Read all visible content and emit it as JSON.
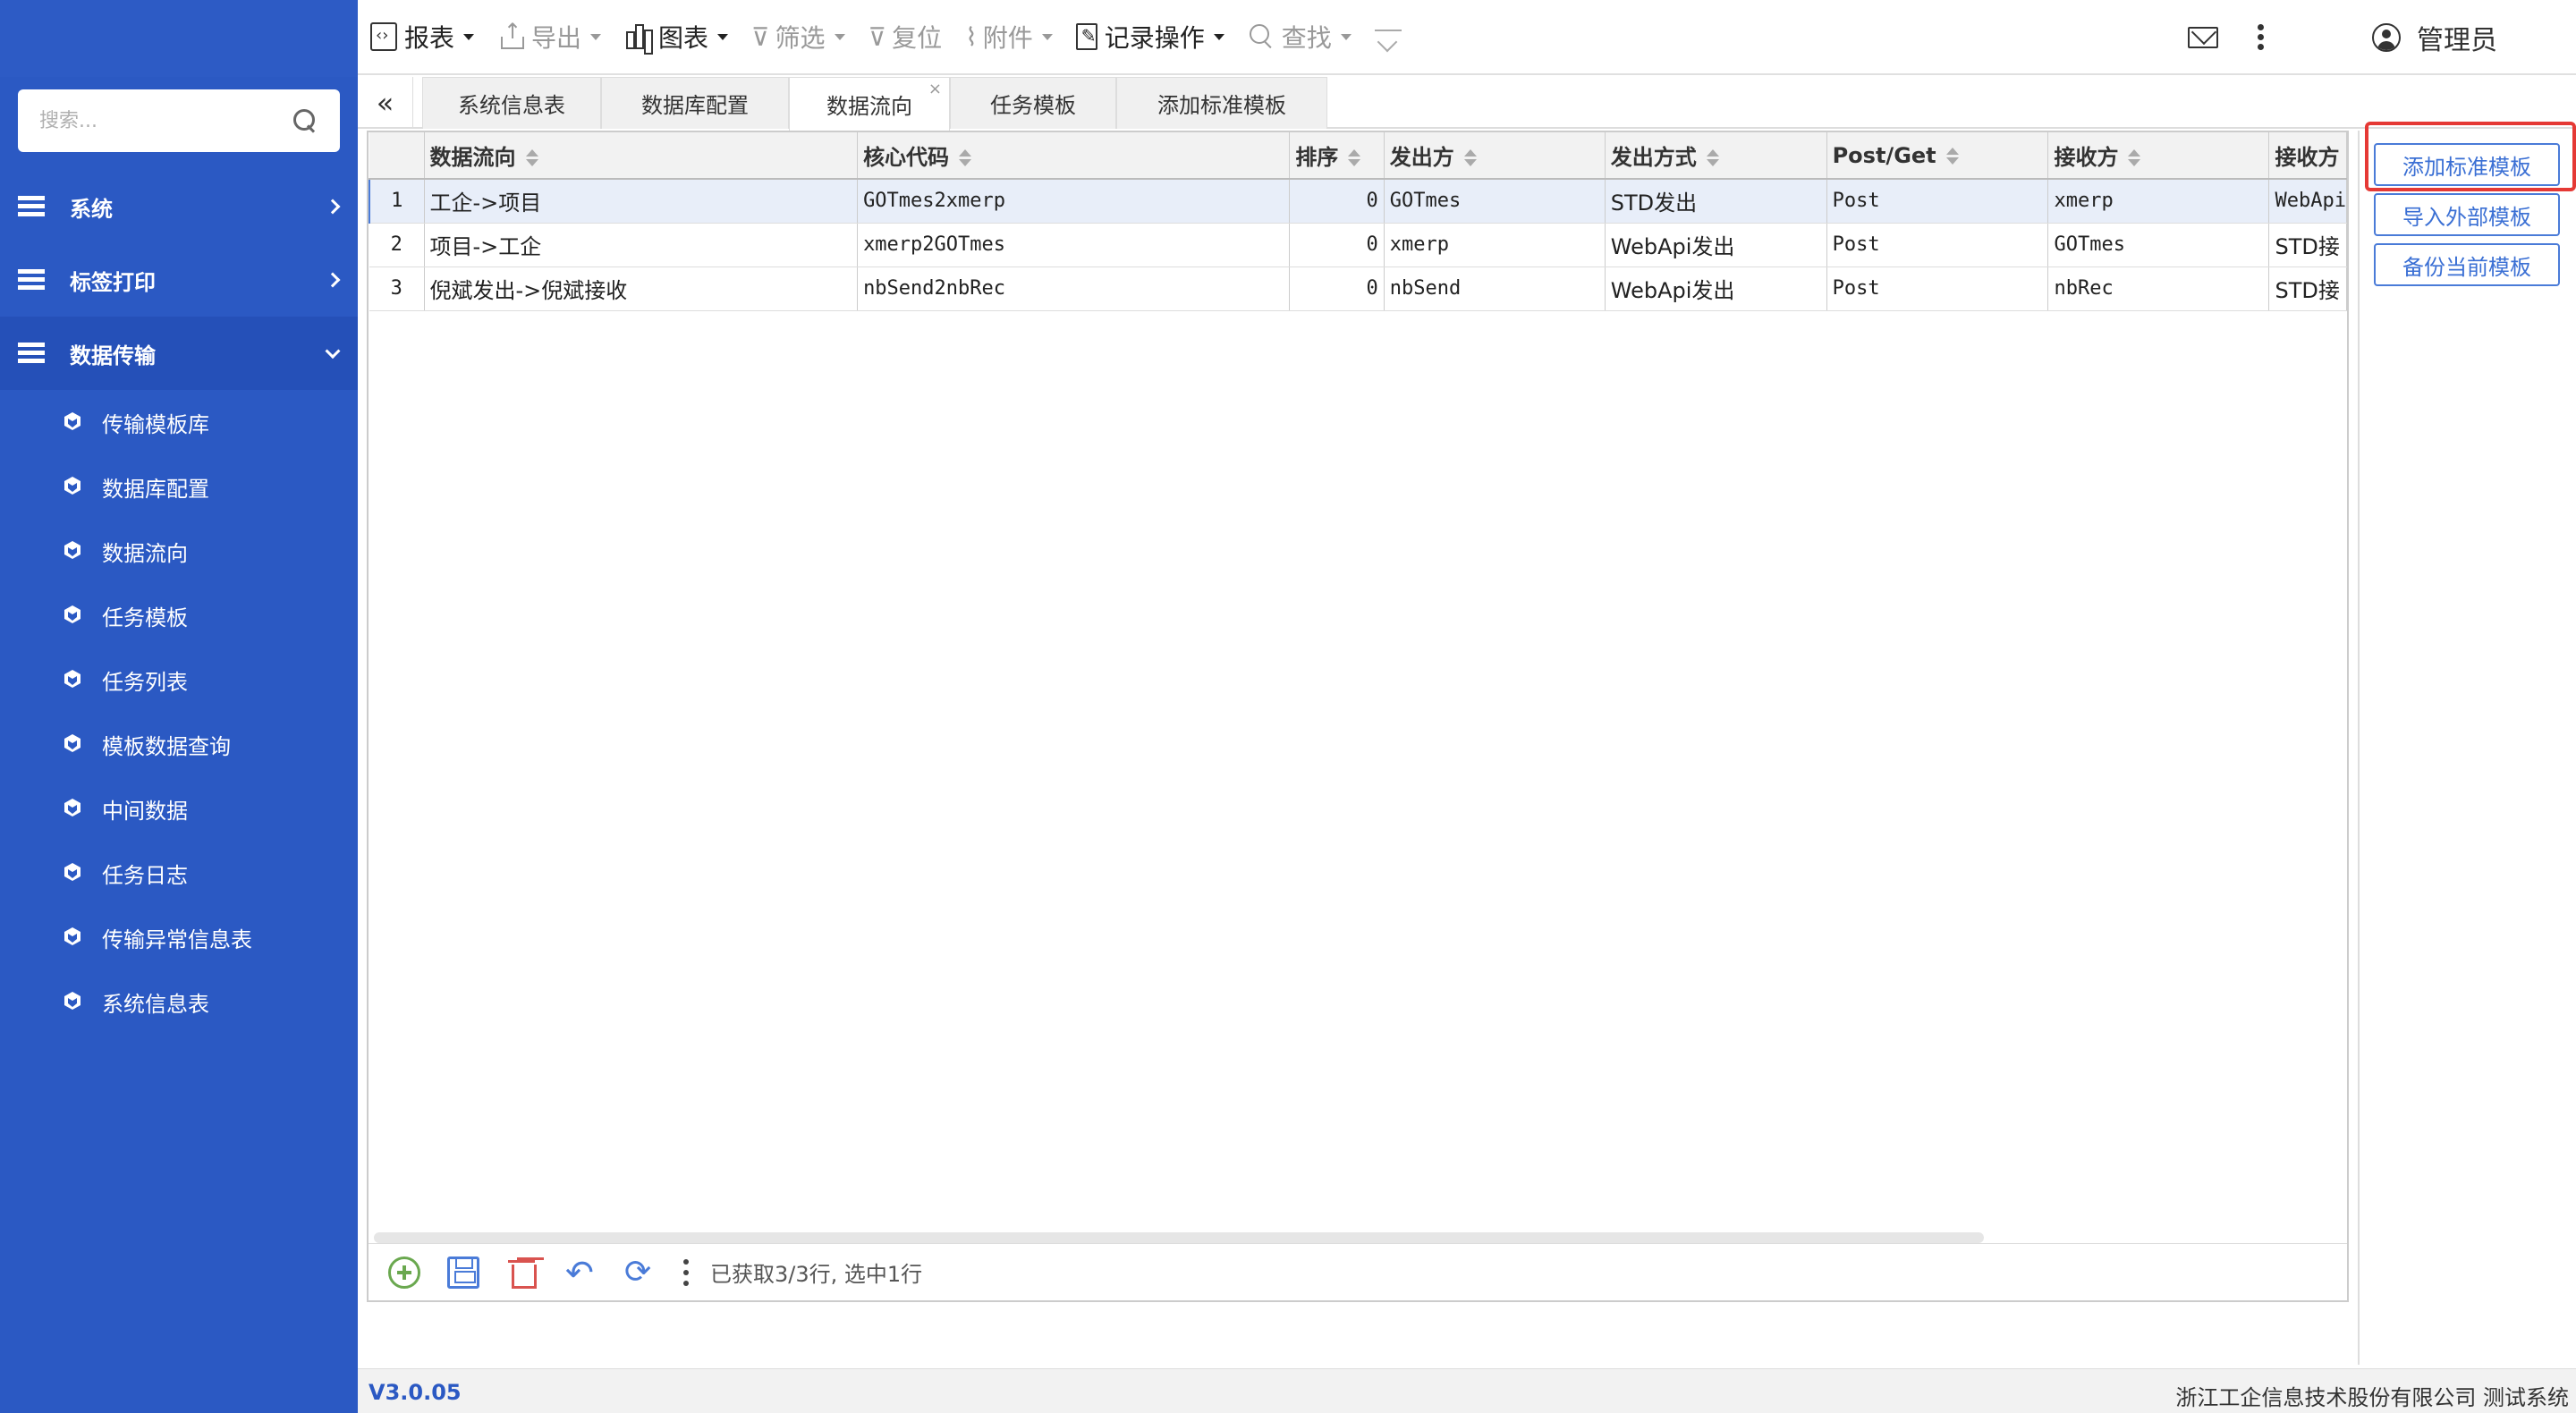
{
  "sidebar": {
    "search_placeholder": "搜索...",
    "groups": [
      {
        "label": "系统"
      },
      {
        "label": "标签打印"
      },
      {
        "label": "数据传输"
      }
    ],
    "subitems": [
      {
        "label": "传输模板库"
      },
      {
        "label": "数据库配置"
      },
      {
        "label": "数据流向"
      },
      {
        "label": "任务模板"
      },
      {
        "label": "任务列表"
      },
      {
        "label": "模板数据查询"
      },
      {
        "label": "中间数据"
      },
      {
        "label": "任务日志"
      },
      {
        "label": "传输异常信息表"
      },
      {
        "label": "系统信息表"
      }
    ]
  },
  "toolbar": {
    "report": "报表",
    "export": "导出",
    "chart": "图表",
    "filter": "筛选",
    "reset": "复位",
    "attachment": "附件",
    "record_ops": "记录操作",
    "find": "查找",
    "user": "管理员"
  },
  "tabs": [
    {
      "label": "系统信息表"
    },
    {
      "label": "数据库配置"
    },
    {
      "label": "数据流向",
      "active": true,
      "close": "×"
    },
    {
      "label": "任务模板"
    },
    {
      "label": "添加标准模板"
    }
  ],
  "collapse_label": "«",
  "table": {
    "headers": [
      "数据流向",
      "核心代码",
      "排序",
      "发出方",
      "发出方式",
      "Post/Get",
      "接收方",
      "接收方"
    ],
    "rows": [
      {
        "rn": "1",
        "flow": "工企->项目",
        "code": "GOTmes2xmerp",
        "order": "0",
        "sender": "GOTmes",
        "send_mode": "STD发出",
        "method": "Post",
        "receiver": "xmerp",
        "recv_mode": "WebApi"
      },
      {
        "rn": "2",
        "flow": "项目->工企",
        "code": "xmerp2GOTmes",
        "order": "0",
        "sender": "xmerp",
        "send_mode": "WebApi发出",
        "method": "Post",
        "receiver": "GOTmes",
        "recv_mode": "STD接"
      },
      {
        "rn": "3",
        "flow": "倪斌发出->倪斌接收",
        "code": "nbSend2nbRec",
        "order": "0",
        "sender": "nbSend",
        "send_mode": "WebApi发出",
        "method": "Post",
        "receiver": "nbRec",
        "recv_mode": "STD接"
      }
    ],
    "selected_row": 1,
    "status": "已获取3/3行, 选中1行"
  },
  "right_panel": {
    "add_standard": "添加标准模板",
    "import_external": "导入外部模板",
    "backup_current": "备份当前模板"
  },
  "footer": {
    "version": "V3.0.05",
    "company": "浙江工企信息技术股份有限公司 测试系统"
  },
  "colors": {
    "sidebar": "#2b59c3",
    "accent": "#4a7bd8",
    "highlight": "#e53935"
  }
}
